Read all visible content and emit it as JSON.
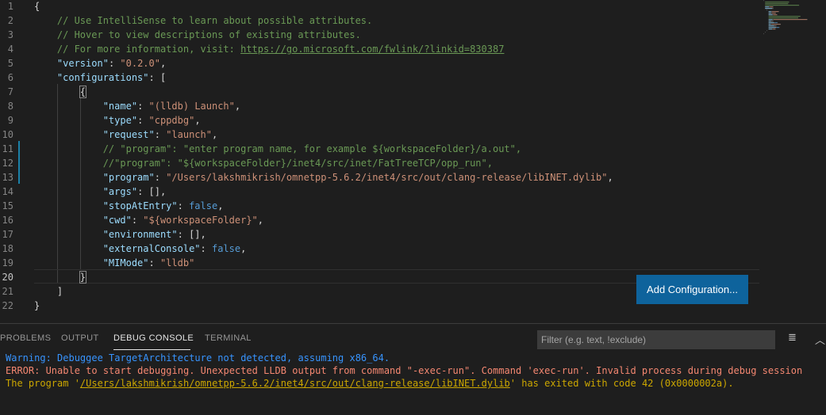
{
  "editor": {
    "current_line": 20,
    "lines": [
      {
        "n": "1",
        "t": [
          [
            "p",
            "{"
          ]
        ]
      },
      {
        "n": "2",
        "t": [
          [
            "p",
            "    "
          ],
          [
            "com",
            "// Use IntelliSense to learn about possible attributes."
          ]
        ]
      },
      {
        "n": "3",
        "t": [
          [
            "p",
            "    "
          ],
          [
            "com",
            "// Hover to view descriptions of existing attributes."
          ]
        ]
      },
      {
        "n": "4",
        "t": [
          [
            "p",
            "    "
          ],
          [
            "com",
            "// For more information, visit: "
          ],
          [
            "link",
            "https://go.microsoft.com/fwlink/?linkid=830387"
          ]
        ]
      },
      {
        "n": "5",
        "t": [
          [
            "p",
            "    "
          ],
          [
            "key",
            "\"version\""
          ],
          [
            "p",
            ": "
          ],
          [
            "str",
            "\"0.2.0\""
          ],
          [
            "p",
            ","
          ]
        ]
      },
      {
        "n": "6",
        "t": [
          [
            "p",
            "    "
          ],
          [
            "key",
            "\"configurations\""
          ],
          [
            "p",
            ": ["
          ]
        ]
      },
      {
        "n": "7",
        "t": [
          [
            "p",
            "        "
          ],
          [
            "p",
            "{"
          ]
        ]
      },
      {
        "n": "8",
        "t": [
          [
            "p",
            "            "
          ],
          [
            "key",
            "\"name\""
          ],
          [
            "p",
            ": "
          ],
          [
            "str",
            "\"(lldb) Launch\""
          ],
          [
            "p",
            ","
          ]
        ]
      },
      {
        "n": "9",
        "t": [
          [
            "p",
            "            "
          ],
          [
            "key",
            "\"type\""
          ],
          [
            "p",
            ": "
          ],
          [
            "str",
            "\"cppdbg\""
          ],
          [
            "p",
            ","
          ]
        ]
      },
      {
        "n": "10",
        "t": [
          [
            "p",
            "            "
          ],
          [
            "key",
            "\"request\""
          ],
          [
            "p",
            ": "
          ],
          [
            "str",
            "\"launch\""
          ],
          [
            "p",
            ","
          ]
        ]
      },
      {
        "n": "11",
        "t": [
          [
            "p",
            "            "
          ],
          [
            "com",
            "// \"program\": \"enter program name, for example ${workspaceFolder}/a.out\","
          ]
        ]
      },
      {
        "n": "12",
        "t": [
          [
            "p",
            "            "
          ],
          [
            "com",
            "//\"program\": \"${workspaceFolder}/inet4/src/inet/FatTreeTCP/opp_run\","
          ]
        ]
      },
      {
        "n": "13",
        "t": [
          [
            "p",
            "            "
          ],
          [
            "key",
            "\"program\""
          ],
          [
            "p",
            ": "
          ],
          [
            "str",
            "\"/Users/lakshmikrish/omnetpp-5.6.2/inet4/src/out/clang-release/libINET.dylib\""
          ],
          [
            "p",
            ","
          ]
        ]
      },
      {
        "n": "14",
        "t": [
          [
            "p",
            "            "
          ],
          [
            "key",
            "\"args\""
          ],
          [
            "p",
            ": [],"
          ]
        ]
      },
      {
        "n": "15",
        "t": [
          [
            "p",
            "            "
          ],
          [
            "key",
            "\"stopAtEntry\""
          ],
          [
            "p",
            ": "
          ],
          [
            "kw",
            "false"
          ],
          [
            "p",
            ","
          ]
        ]
      },
      {
        "n": "16",
        "t": [
          [
            "p",
            "            "
          ],
          [
            "key",
            "\"cwd\""
          ],
          [
            "p",
            ": "
          ],
          [
            "str",
            "\"${workspaceFolder}\""
          ],
          [
            "p",
            ","
          ]
        ]
      },
      {
        "n": "17",
        "t": [
          [
            "p",
            "            "
          ],
          [
            "key",
            "\"environment\""
          ],
          [
            "p",
            ": [],"
          ]
        ]
      },
      {
        "n": "18",
        "t": [
          [
            "p",
            "            "
          ],
          [
            "key",
            "\"externalConsole\""
          ],
          [
            "p",
            ": "
          ],
          [
            "kw",
            "false"
          ],
          [
            "p",
            ","
          ]
        ]
      },
      {
        "n": "19",
        "t": [
          [
            "p",
            "            "
          ],
          [
            "key",
            "\"MIMode\""
          ],
          [
            "p",
            ": "
          ],
          [
            "str",
            "\"lldb\""
          ]
        ]
      },
      {
        "n": "20",
        "t": [
          [
            "p",
            "        "
          ],
          [
            "p",
            "}"
          ]
        ]
      },
      {
        "n": "21",
        "t": [
          [
            "p",
            "    "
          ],
          [
            "p",
            "]"
          ]
        ]
      },
      {
        "n": "22",
        "t": [
          [
            "p",
            "}"
          ]
        ]
      }
    ]
  },
  "add_configuration_label": "Add Configuration...",
  "panel": {
    "tabs": [
      "PROBLEMS",
      "OUTPUT",
      "DEBUG CONSOLE",
      "TERMINAL"
    ],
    "active_tab": "DEBUG CONSOLE",
    "filter_placeholder": "Filter (e.g. text, !exclude)",
    "icons": [
      "clear-console-icon",
      "chevron-up-icon"
    ],
    "output": {
      "warning": "Warning: Debuggee TargetArchitecture not detected, assuming x86_64.",
      "error": "ERROR: Unable to start debugging. Unexpected LLDB output from command \"-exec-run\". Command 'exec-run'. Invalid process during debug session",
      "exit_prefix": "The program '",
      "exit_path": "/Users/lakshmikrish/omnetpp-5.6.2/inet4/src/out/clang-release/libINET.dylib",
      "exit_suffix": "' has exited with code 42 (0x0000002a)."
    }
  },
  "colors": {
    "key": "#9cdcfe",
    "string": "#ce9178",
    "keyword": "#569cd6",
    "comment": "#6a9955",
    "button": "#0e639c",
    "warning": "#3794ff",
    "error": "#f48771",
    "info": "#cca700"
  }
}
